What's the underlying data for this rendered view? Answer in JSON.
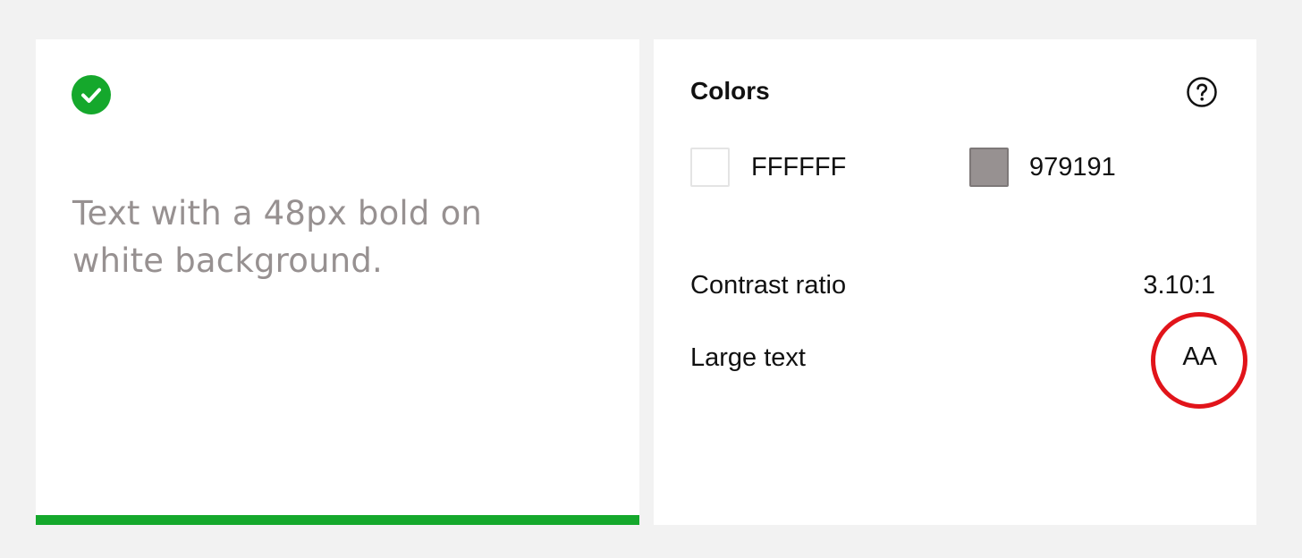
{
  "colors": {
    "background": "#f2f2f2",
    "card": "#ffffff",
    "success": "#15a82c",
    "sample_text": "#979191",
    "highlight": "#e1141a"
  },
  "preview": {
    "status_icon": "check-circle-icon",
    "sample_text_line1": "Text with a 48px bold on",
    "sample_text_line2": "white background."
  },
  "panel": {
    "title": "Colors",
    "help_icon": "question-circle-icon",
    "foreground": {
      "hex": "FFFFFF",
      "swatch": "#ffffff"
    },
    "background": {
      "hex": "979191",
      "swatch": "#979191"
    },
    "contrast_label": "Contrast ratio",
    "contrast_value": "3.10:1",
    "large_text_label": "Large text",
    "large_text_value": "AA"
  }
}
